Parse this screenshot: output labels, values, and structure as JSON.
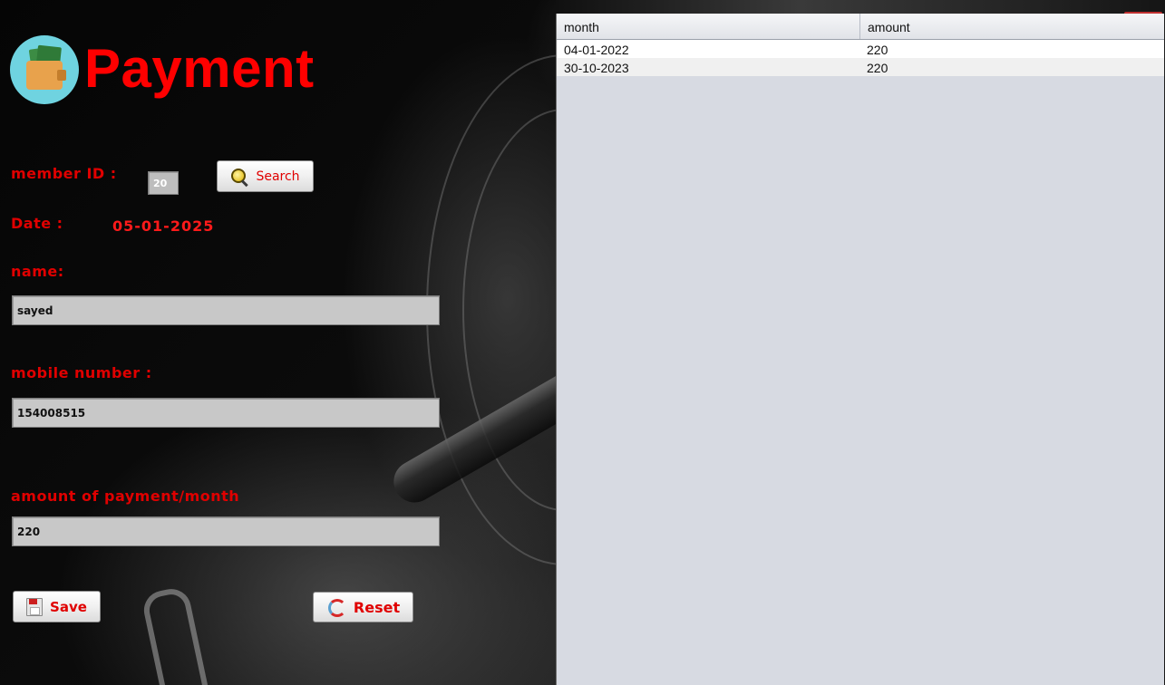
{
  "header": {
    "title": "Payment",
    "logo_icon": "wallet-money-icon"
  },
  "form": {
    "member_id_label": "member ID :",
    "member_id_value": "20",
    "search_button_label": "Search",
    "date_label": "Date :",
    "date_value": "05-01-2025",
    "name_label": "name:",
    "name_value": "sayed",
    "mobile_label": "mobile number :",
    "mobile_value": "154008515",
    "amount_label": "amount of payment/month",
    "amount_value": "220",
    "save_button_label": "Save",
    "reset_button_label": "Reset"
  },
  "table": {
    "columns": [
      "month",
      "amount"
    ],
    "rows": [
      {
        "month": "04-01-2022",
        "amount": "220"
      },
      {
        "month": "30-10-2023",
        "amount": "220"
      }
    ]
  },
  "colors": {
    "accent_red": "#ff0000",
    "table_bg": "#d7dae2"
  }
}
